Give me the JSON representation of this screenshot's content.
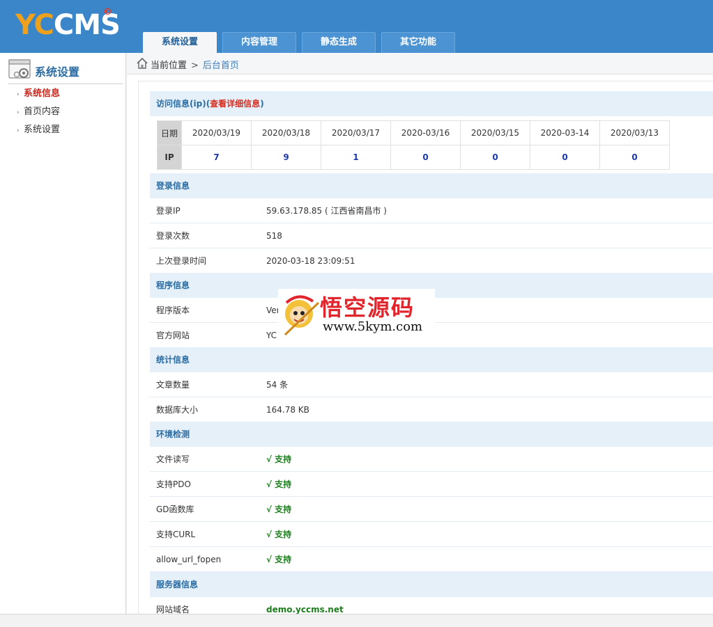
{
  "logo": {
    "part1": "YC",
    "part2": "CMS",
    "mark": "©"
  },
  "nav": {
    "tabs": [
      "系统设置",
      "内容管理",
      "静态生成",
      "其它功能"
    ],
    "active": 0
  },
  "sidebar": {
    "title": "系统设置",
    "icon": "settings-window-icon",
    "items": [
      "系统信息",
      "首页内容",
      "系统设置"
    ]
  },
  "breadcrumb": {
    "icon": "home-icon",
    "label": "当前位置",
    "sep": ">",
    "current": "后台首页"
  },
  "visit": {
    "title": "访问信息(ip)",
    "link_open": "(",
    "link": "查看详细信息",
    "link_close": ")",
    "date_label": "日期",
    "ip_label": "IP",
    "dates": [
      "2020/03/19",
      "2020/03/18",
      "2020/03/17",
      "2020-03/16",
      "2020/03/15",
      "2020-03-14",
      "2020/03/13"
    ],
    "counts": [
      "7",
      "9",
      "1",
      "0",
      "0",
      "0",
      "0"
    ]
  },
  "login": {
    "title": "登录信息",
    "rows": [
      {
        "k": "登录IP",
        "v": "59.63.178.85 ( 江西省南昌市 )"
      },
      {
        "k": "登录次数",
        "v": "518"
      },
      {
        "k": "上次登录时间",
        "v": "2020-03-18 23:09:51"
      }
    ]
  },
  "program": {
    "title": "程序信息",
    "rows": [
      {
        "k": "程序版本",
        "v": "Ver"
      },
      {
        "k": "官方网站",
        "v": "YC"
      }
    ]
  },
  "stats": {
    "title": "统计信息",
    "rows": [
      {
        "k": "文章数量",
        "v": "54 条"
      },
      {
        "k": "数据库大小",
        "v": "164.78 KB"
      }
    ]
  },
  "env": {
    "title": "环境检测",
    "rows": [
      {
        "k": "文件读写",
        "v": "√ 支持"
      },
      {
        "k": "支持PDO",
        "v": "√ 支持"
      },
      {
        "k": "GD函数库",
        "v": "√ 支持"
      },
      {
        "k": "支持CURL",
        "v": "√ 支持"
      },
      {
        "k": "allow_url_fopen",
        "v": "√ 支持"
      }
    ]
  },
  "server": {
    "title": "服务器信息",
    "rows": [
      {
        "k": "网站域名",
        "v": "demo.yccms.net"
      }
    ]
  },
  "watermark": {
    "title": "悟空源码",
    "url": "www.5kym.com",
    "icon": "monkey-king-icon"
  },
  "colors": {
    "header": "#3a86c8",
    "accent": "#c8281e",
    "ok": "#1b7d1b",
    "section": "#e6f0f9"
  }
}
